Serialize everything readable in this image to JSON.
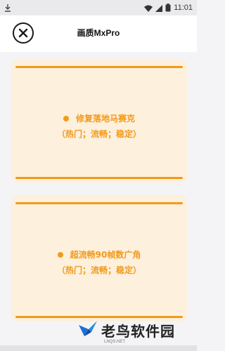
{
  "status_bar": {
    "time": "11:01"
  },
  "header": {
    "title": "画质MxPro",
    "close_icon": "close-icon"
  },
  "cards": [
    {
      "title": "修复落地马赛克",
      "subtitle": "（热门；流畅；稳定）"
    },
    {
      "title": "超流畅90帧数广角",
      "subtitle": "（热门；流畅；稳定）"
    }
  ],
  "watermark": {
    "text": "老鸟软件园",
    "sub": "LNQS.NET"
  },
  "colors": {
    "accent": "#f29a1b",
    "card_bg": "#fdf0dc",
    "page_bg": "#f4f4f6"
  }
}
